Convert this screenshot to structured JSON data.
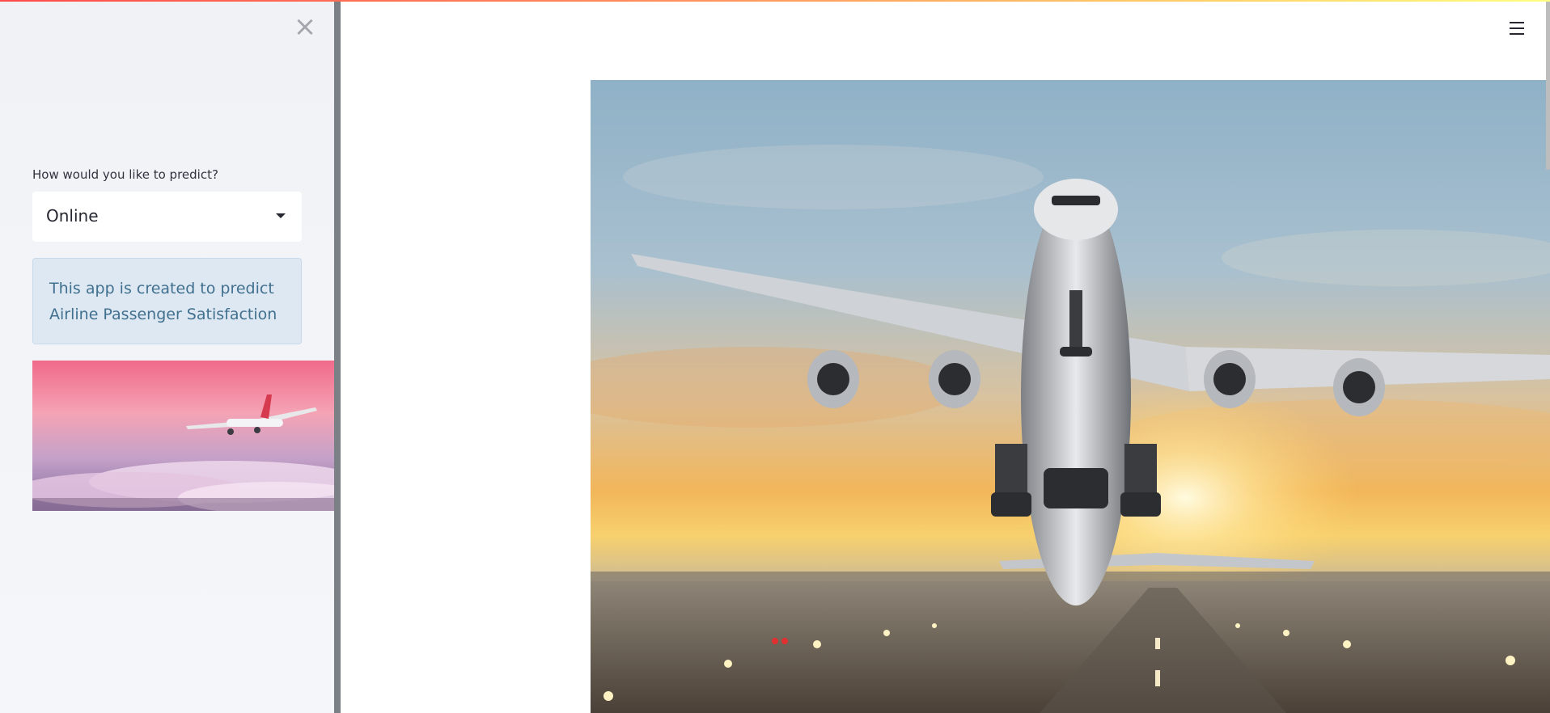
{
  "sidebar": {
    "close_icon": "close-icon",
    "predict_label": "How would you like to predict?",
    "predict_select": {
      "selected": "Online"
    },
    "info_text": "This app is created to predict Airline Passenger Satisfaction",
    "side_image": {
      "icon": "airplane-sunset-image"
    }
  },
  "main": {
    "menu_icon": "hamburger-menu-icon",
    "hero_image": {
      "icon": "airplane-takeoff-image"
    }
  },
  "colors": {
    "accent": "#ff4b4b",
    "sidebar_bg": "#f0f2f6",
    "info_bg": "#dde8f3",
    "info_text": "#41708f"
  }
}
